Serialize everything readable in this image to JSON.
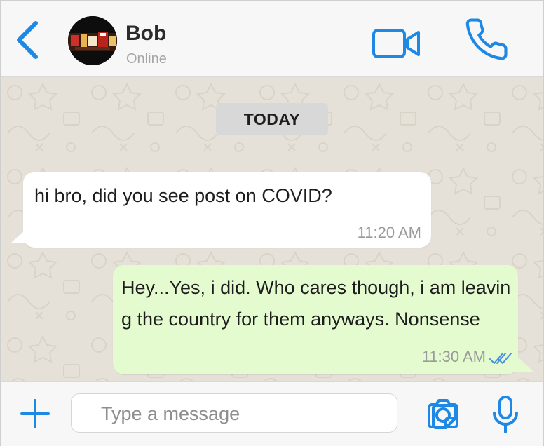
{
  "header": {
    "contact_name": "Bob",
    "status": "Online",
    "icons": {
      "back": "chevron-left-icon",
      "video": "video-camera-icon",
      "call": "phone-icon"
    }
  },
  "chat": {
    "date_label": "TODAY",
    "messages": [
      {
        "direction": "incoming",
        "text": "hi bro, did you see post on COVID?",
        "time": "11:20 AM"
      },
      {
        "direction": "outgoing",
        "text": "Hey...Yes, i did. Who cares though, i am leaving the country for them anyways. Nonsense",
        "time": "11:30 AM",
        "read": true
      }
    ]
  },
  "input": {
    "placeholder": "Type a message",
    "value": "",
    "icons": {
      "add": "plus-icon",
      "sticker": "sticker-icon",
      "camera": "camera-icon",
      "mic": "microphone-icon"
    }
  },
  "colors": {
    "accent": "#1e88e5",
    "header_bg": "#f7f7f7",
    "chat_bg": "#e6e1d8",
    "incoming_bubble": "#ffffff",
    "outgoing_bubble": "#e3fbcf",
    "date_chip": "#d8d8d8",
    "read_ticks": "#4a90e2"
  }
}
